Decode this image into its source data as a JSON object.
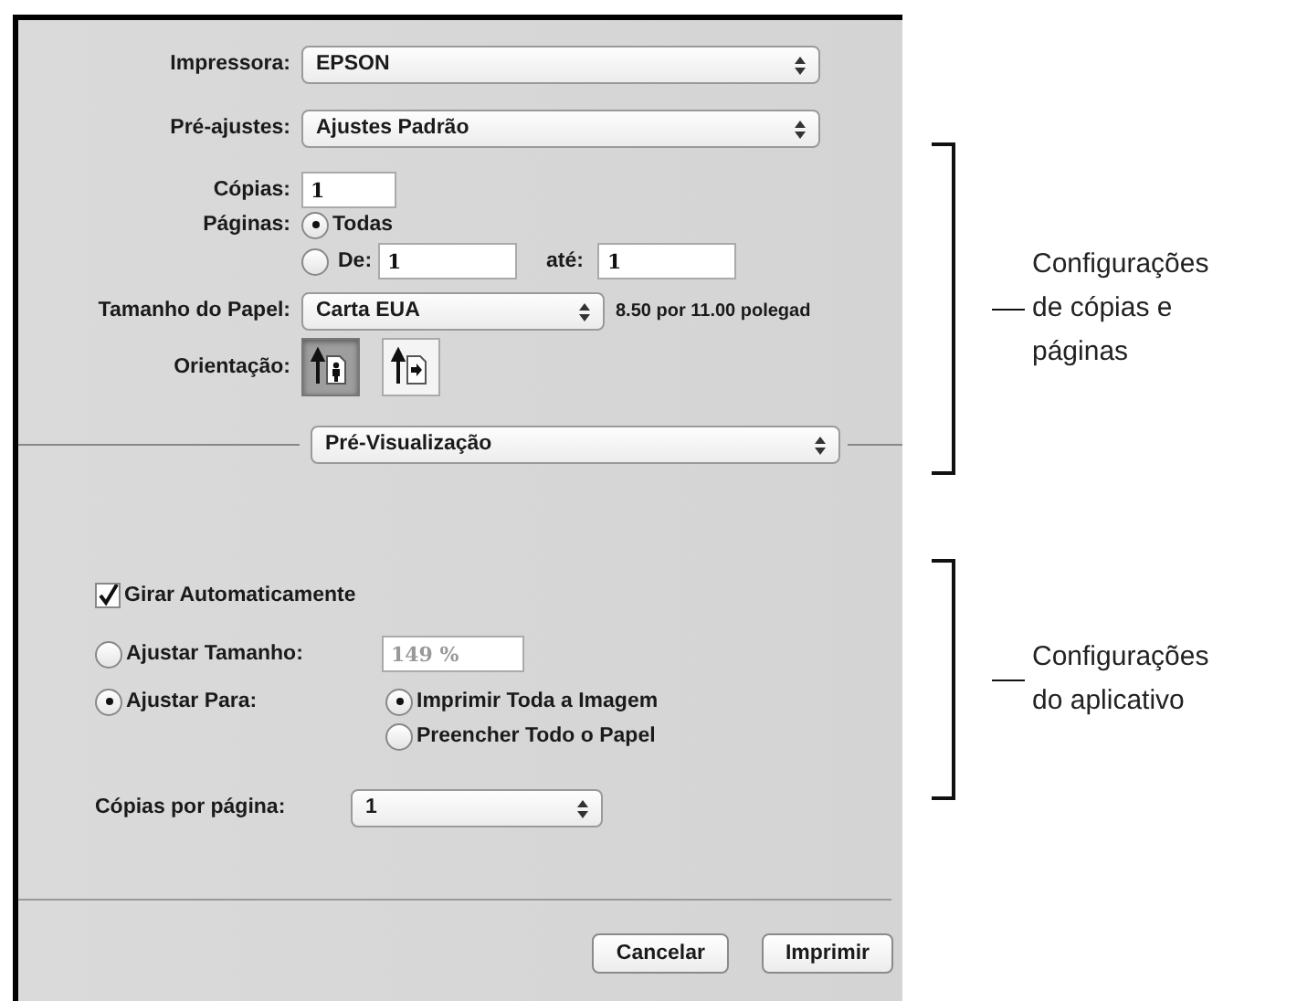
{
  "print_dialog": {
    "printer": {
      "label": "Impressora:",
      "value": "EPSON"
    },
    "presets": {
      "label": "Pré-ajustes:",
      "value": "Ajustes Padrão"
    },
    "copies": {
      "label": "Cópias:",
      "value": "1"
    },
    "pages": {
      "label": "Páginas:",
      "options": [
        {
          "label": "Todas",
          "selected": true
        },
        {
          "label": "De:",
          "selected": false
        }
      ],
      "from": "1",
      "to_label": "até:",
      "to": "1"
    },
    "paper_size": {
      "label": "Tamanho do Papel:",
      "value": "Carta EUA",
      "dimensions": "8.50 por 11.00 polegad"
    },
    "orientation": {
      "label": "Orientação:",
      "options": [
        {
          "kind": "portrait",
          "selected": true
        },
        {
          "kind": "landscape",
          "selected": false
        }
      ]
    },
    "section_popup": "Pré-Visualização",
    "auto_rotate": {
      "label": "Girar Automaticamente",
      "checked": true
    },
    "scaling": [
      {
        "kind": "scale",
        "label": "Ajustar Tamanho:",
        "selected": false,
        "value": "149 %"
      },
      {
        "kind": "fit",
        "label": "Ajustar Para:",
        "selected": true,
        "options": [
          {
            "label": "Imprimir Toda a Imagem",
            "selected": true
          },
          {
            "label": "Preencher Todo o Papel",
            "selected": false
          }
        ]
      }
    ],
    "copies_per_page": {
      "label": "Cópias por página:",
      "value": "1"
    },
    "buttons": [
      "Cancelar",
      "Imprimir"
    ]
  },
  "callouts": [
    {
      "text": "Configurações\nde cópias e\npáginas"
    },
    {
      "text": "Configurações\ndo aplicativo"
    }
  ]
}
